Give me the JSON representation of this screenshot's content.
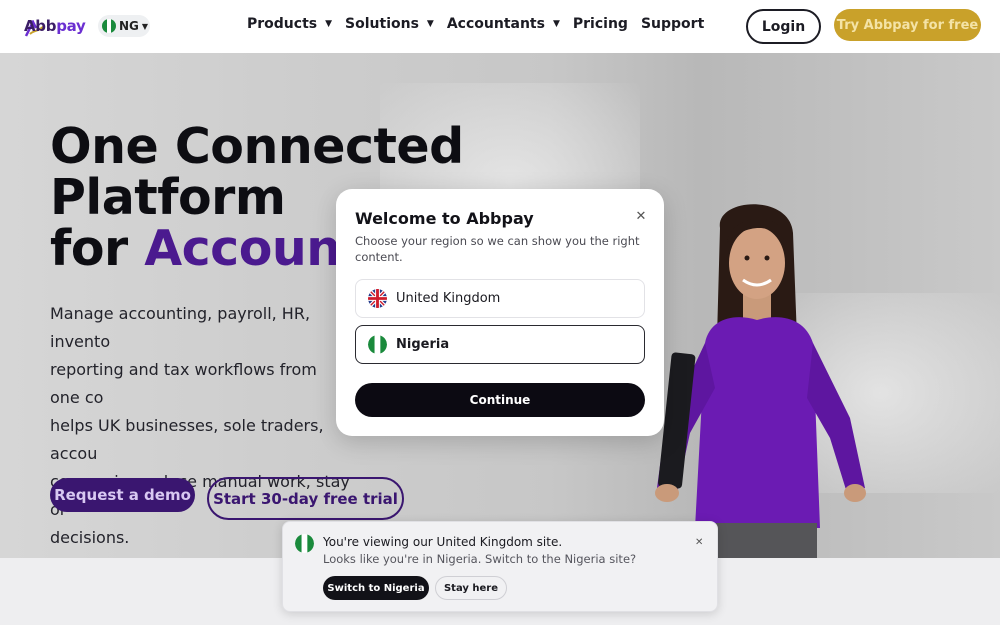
{
  "header": {
    "logo_text_main": "Abb",
    "logo_text_accent": "pay",
    "region_code": "NG",
    "nav": [
      {
        "label": "Products",
        "has_dropdown": true
      },
      {
        "label": "Solutions",
        "has_dropdown": true
      },
      {
        "label": "Accountants",
        "has_dropdown": true
      },
      {
        "label": "Pricing",
        "has_dropdown": false
      },
      {
        "label": "Support",
        "has_dropdown": false
      }
    ],
    "login_label": "Login",
    "try_label": "Try Abbpay for free"
  },
  "hero": {
    "title_line1": "One Connected",
    "title_line2": "Platform",
    "title_line3_prefix": "for ",
    "title_line3_highlight": "Accounti",
    "description": "Manage accounting, payroll, HR, invento\nreporting and tax workflows from one co\nhelps UK businesses, sole traders, accou\ncompanies reduce manual work, stay or\ndecisions.",
    "demo_label": "Request a demo",
    "trial_label": "Start 30-day free trial"
  },
  "modal": {
    "title": "Welcome to Abbpay",
    "subtitle": "Choose your region so we can show you the right content.",
    "options": [
      {
        "label": "United Kingdom",
        "flag": "uk-flag-icon",
        "selected": false
      },
      {
        "label": "Nigeria",
        "flag": "nigeria-flag-icon",
        "selected": true
      }
    ],
    "continue_label": "Continue"
  },
  "toast": {
    "title": "You're viewing our United Kingdom site.",
    "subtitle": "Looks like you're in Nigeria. Switch to the Nigeria site?",
    "switch_label": "Switch to Nigeria",
    "stay_label": "Stay here"
  },
  "colors": {
    "brand_purple": "#4b1a8f",
    "gold": "#c9a12a",
    "nigeria_green": "#1a8a3c"
  }
}
